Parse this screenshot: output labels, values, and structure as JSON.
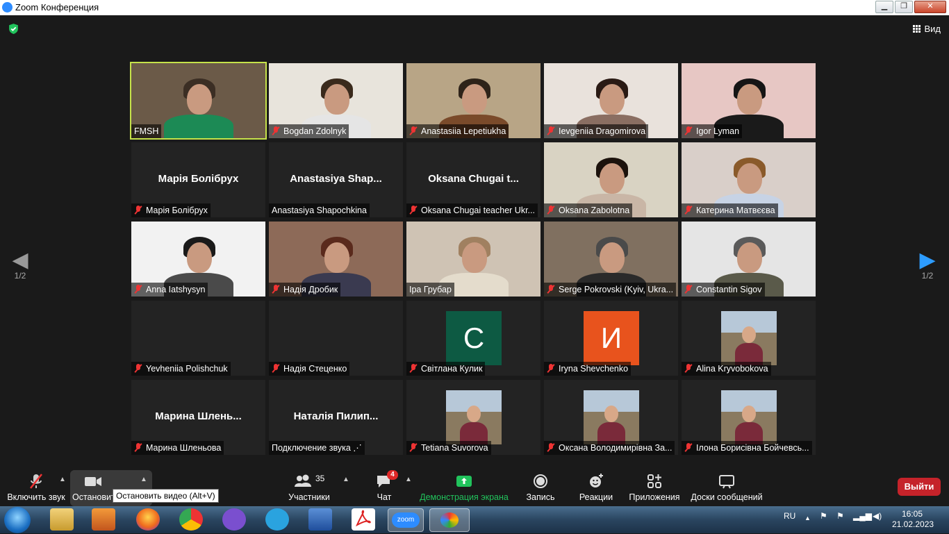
{
  "window": {
    "title": "Zoom Конференция",
    "min": "▁",
    "max": "❐",
    "close": "✕"
  },
  "topbar": {
    "view_label": "Вид"
  },
  "pager": {
    "left": "1/2",
    "right": "1/2"
  },
  "tiles": [
    {
      "name": "FMSH",
      "type": "video",
      "muted": false,
      "active": true
    },
    {
      "name": "Bogdan Zdolnyk",
      "type": "video",
      "muted": true
    },
    {
      "name": "Anastasiia Lepetiukha",
      "type": "video",
      "muted": true
    },
    {
      "name": "Ievgeniia Dragomirova",
      "type": "video",
      "muted": true
    },
    {
      "name": "Igor Lyman",
      "type": "video",
      "muted": true
    },
    {
      "name": "Марія Болібрух",
      "big": "Марія Болібрух",
      "type": "name",
      "muted": true
    },
    {
      "name": "Anastasiya Shapochkina",
      "big": "Anastasiya  Shap...",
      "type": "name",
      "muted": false
    },
    {
      "name": "Oksana Chugai teacher Ukr...",
      "big": "Oksana  Chugai  t...",
      "type": "name",
      "muted": true
    },
    {
      "name": "Oksana Zabolotna",
      "type": "video",
      "muted": true
    },
    {
      "name": "Катерина Матвєєва",
      "type": "video",
      "muted": true
    },
    {
      "name": "Anna Iatshysyn",
      "type": "video",
      "muted": true
    },
    {
      "name": "Надія Дробик",
      "type": "video",
      "muted": true
    },
    {
      "name": "Іра Грубар",
      "type": "video",
      "muted": false
    },
    {
      "name": "Serge Pokrovski (Kyiv, Ukra...",
      "type": "video",
      "muted": true
    },
    {
      "name": "Constantin Sigov",
      "type": "video",
      "muted": true
    },
    {
      "name": "Yevheniia Polishchuk",
      "type": "blank",
      "muted": true
    },
    {
      "name": "Надія Стеценко",
      "type": "blank",
      "muted": true
    },
    {
      "name": "Світлана Кулик",
      "letter": "C",
      "type": "avatar",
      "color": "#0d5a43",
      "muted": true
    },
    {
      "name": "Iryna Shevchenko",
      "letter": "И",
      "type": "avatar",
      "color": "#e8531d",
      "muted": true
    },
    {
      "name": "Alina Kryvobokova",
      "type": "photo",
      "muted": true
    },
    {
      "name": "Марина Шленьова",
      "big": "Марина  Шлень...",
      "type": "name",
      "muted": true
    },
    {
      "name": "Подключение звука ⋰",
      "big": "Наталія  Пилип...",
      "type": "name",
      "muted": false
    },
    {
      "name": "Tetiana Suvorova",
      "type": "photo",
      "muted": true
    },
    {
      "name": "Оксана Володимирівна За...",
      "type": "photo",
      "muted": true
    },
    {
      "name": "Ілона Борисівна Бойчевсь...",
      "type": "photo",
      "muted": true
    }
  ],
  "toolbar": {
    "audio": "Включить звук",
    "video": "Остановить видео",
    "tooltip": "Остановить видео (Alt+V)",
    "participants": "Участники",
    "participants_count": "35",
    "chat": "Чат",
    "chat_badge": "4",
    "share": "Демонстрация экрана",
    "record": "Запись",
    "reactions": "Реакции",
    "apps": "Приложения",
    "whiteboards": "Доски сообщений",
    "leave": "Выйти"
  },
  "taskbar": {
    "lang": "RU",
    "time": "16:05",
    "date": "21.02.2023",
    "zoom_label": "zoom"
  },
  "colors": {
    "accent_green": "#21c35c",
    "leave_red": "#c5232a",
    "active_border": "#c6e24a",
    "muted_red": "#e33333"
  }
}
